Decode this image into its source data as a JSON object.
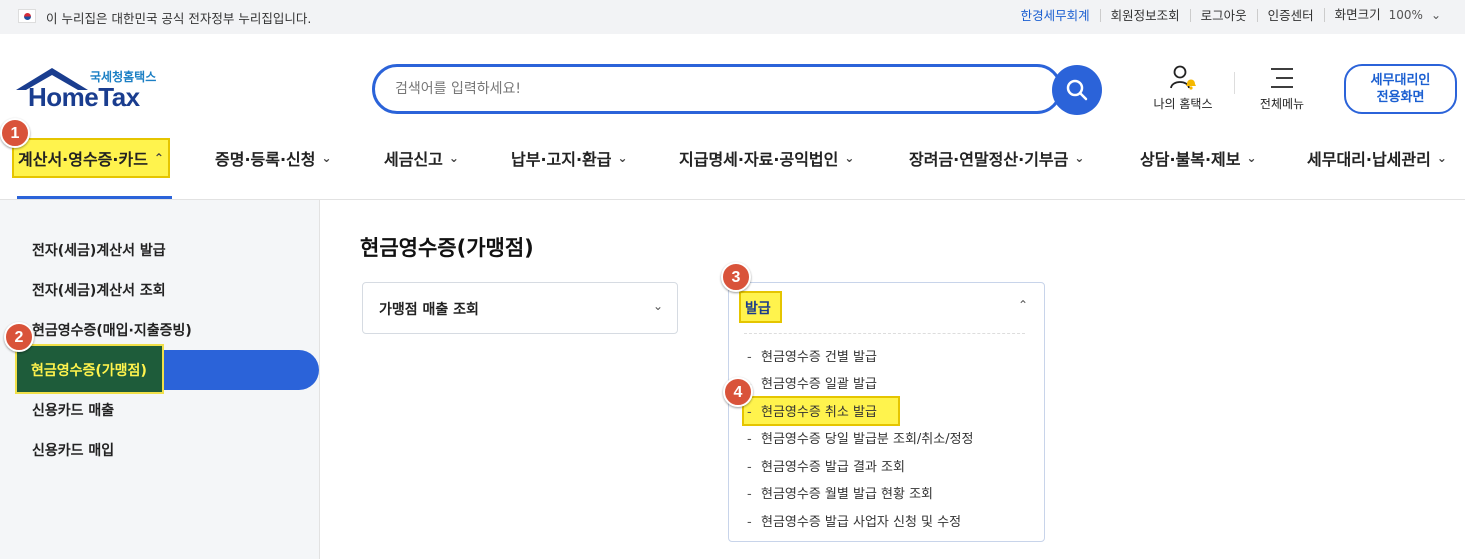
{
  "topbar": {
    "gov_notice": "이 누리집은 대한민국 공식 전자정부 누리집입니다.",
    "links": [
      "한경세무회계",
      "회원정보조회",
      "로그아웃",
      "인증센터",
      "화면크기"
    ],
    "zoom": "100%"
  },
  "header": {
    "logo_sub": "국세청홈택스",
    "logo_main": "HomeTax",
    "search_placeholder": "검색어를 입력하세요!",
    "my_home": "나의 홈택스",
    "all_menu": "전체메뉴",
    "agent_line1": "세무대리인",
    "agent_line2": "전용화면"
  },
  "gnb": [
    "계산서·영수증·카드",
    "증명·등록·신청",
    "세금신고",
    "납부·고지·환급",
    "지급명세·자료·공익법인",
    "장려금·연말정산·기부금",
    "상담·불복·제보",
    "세무대리·납세관리"
  ],
  "sidebar": {
    "items": [
      "전자(세금)계산서 발급",
      "전자(세금)계산서 조회",
      "현금영수증(매입·지출증빙)",
      "현금영수증(가맹점)",
      "신용카드 매출",
      "신용카드 매입"
    ]
  },
  "content": {
    "title": "현금영수증(가맹점)",
    "box1_label": "가맹점 매출 조회",
    "box2_label": "발급",
    "box2_items": [
      "현금영수증 건별 발급",
      "현금영수증 일괄 발급",
      "현금영수증 취소 발급",
      "현금영수증 당일 발급분 조회/취소/정정",
      "현금영수증 발급 결과 조회",
      "현금영수증 월별 발급 현황 조회",
      "현금영수증 발급 사업자 신청 및 수정"
    ]
  },
  "badges": [
    "1",
    "2",
    "3",
    "4"
  ],
  "colors": {
    "accent": "#2b63d9",
    "highlight": "#fff34d",
    "badge": "#d9533a"
  }
}
